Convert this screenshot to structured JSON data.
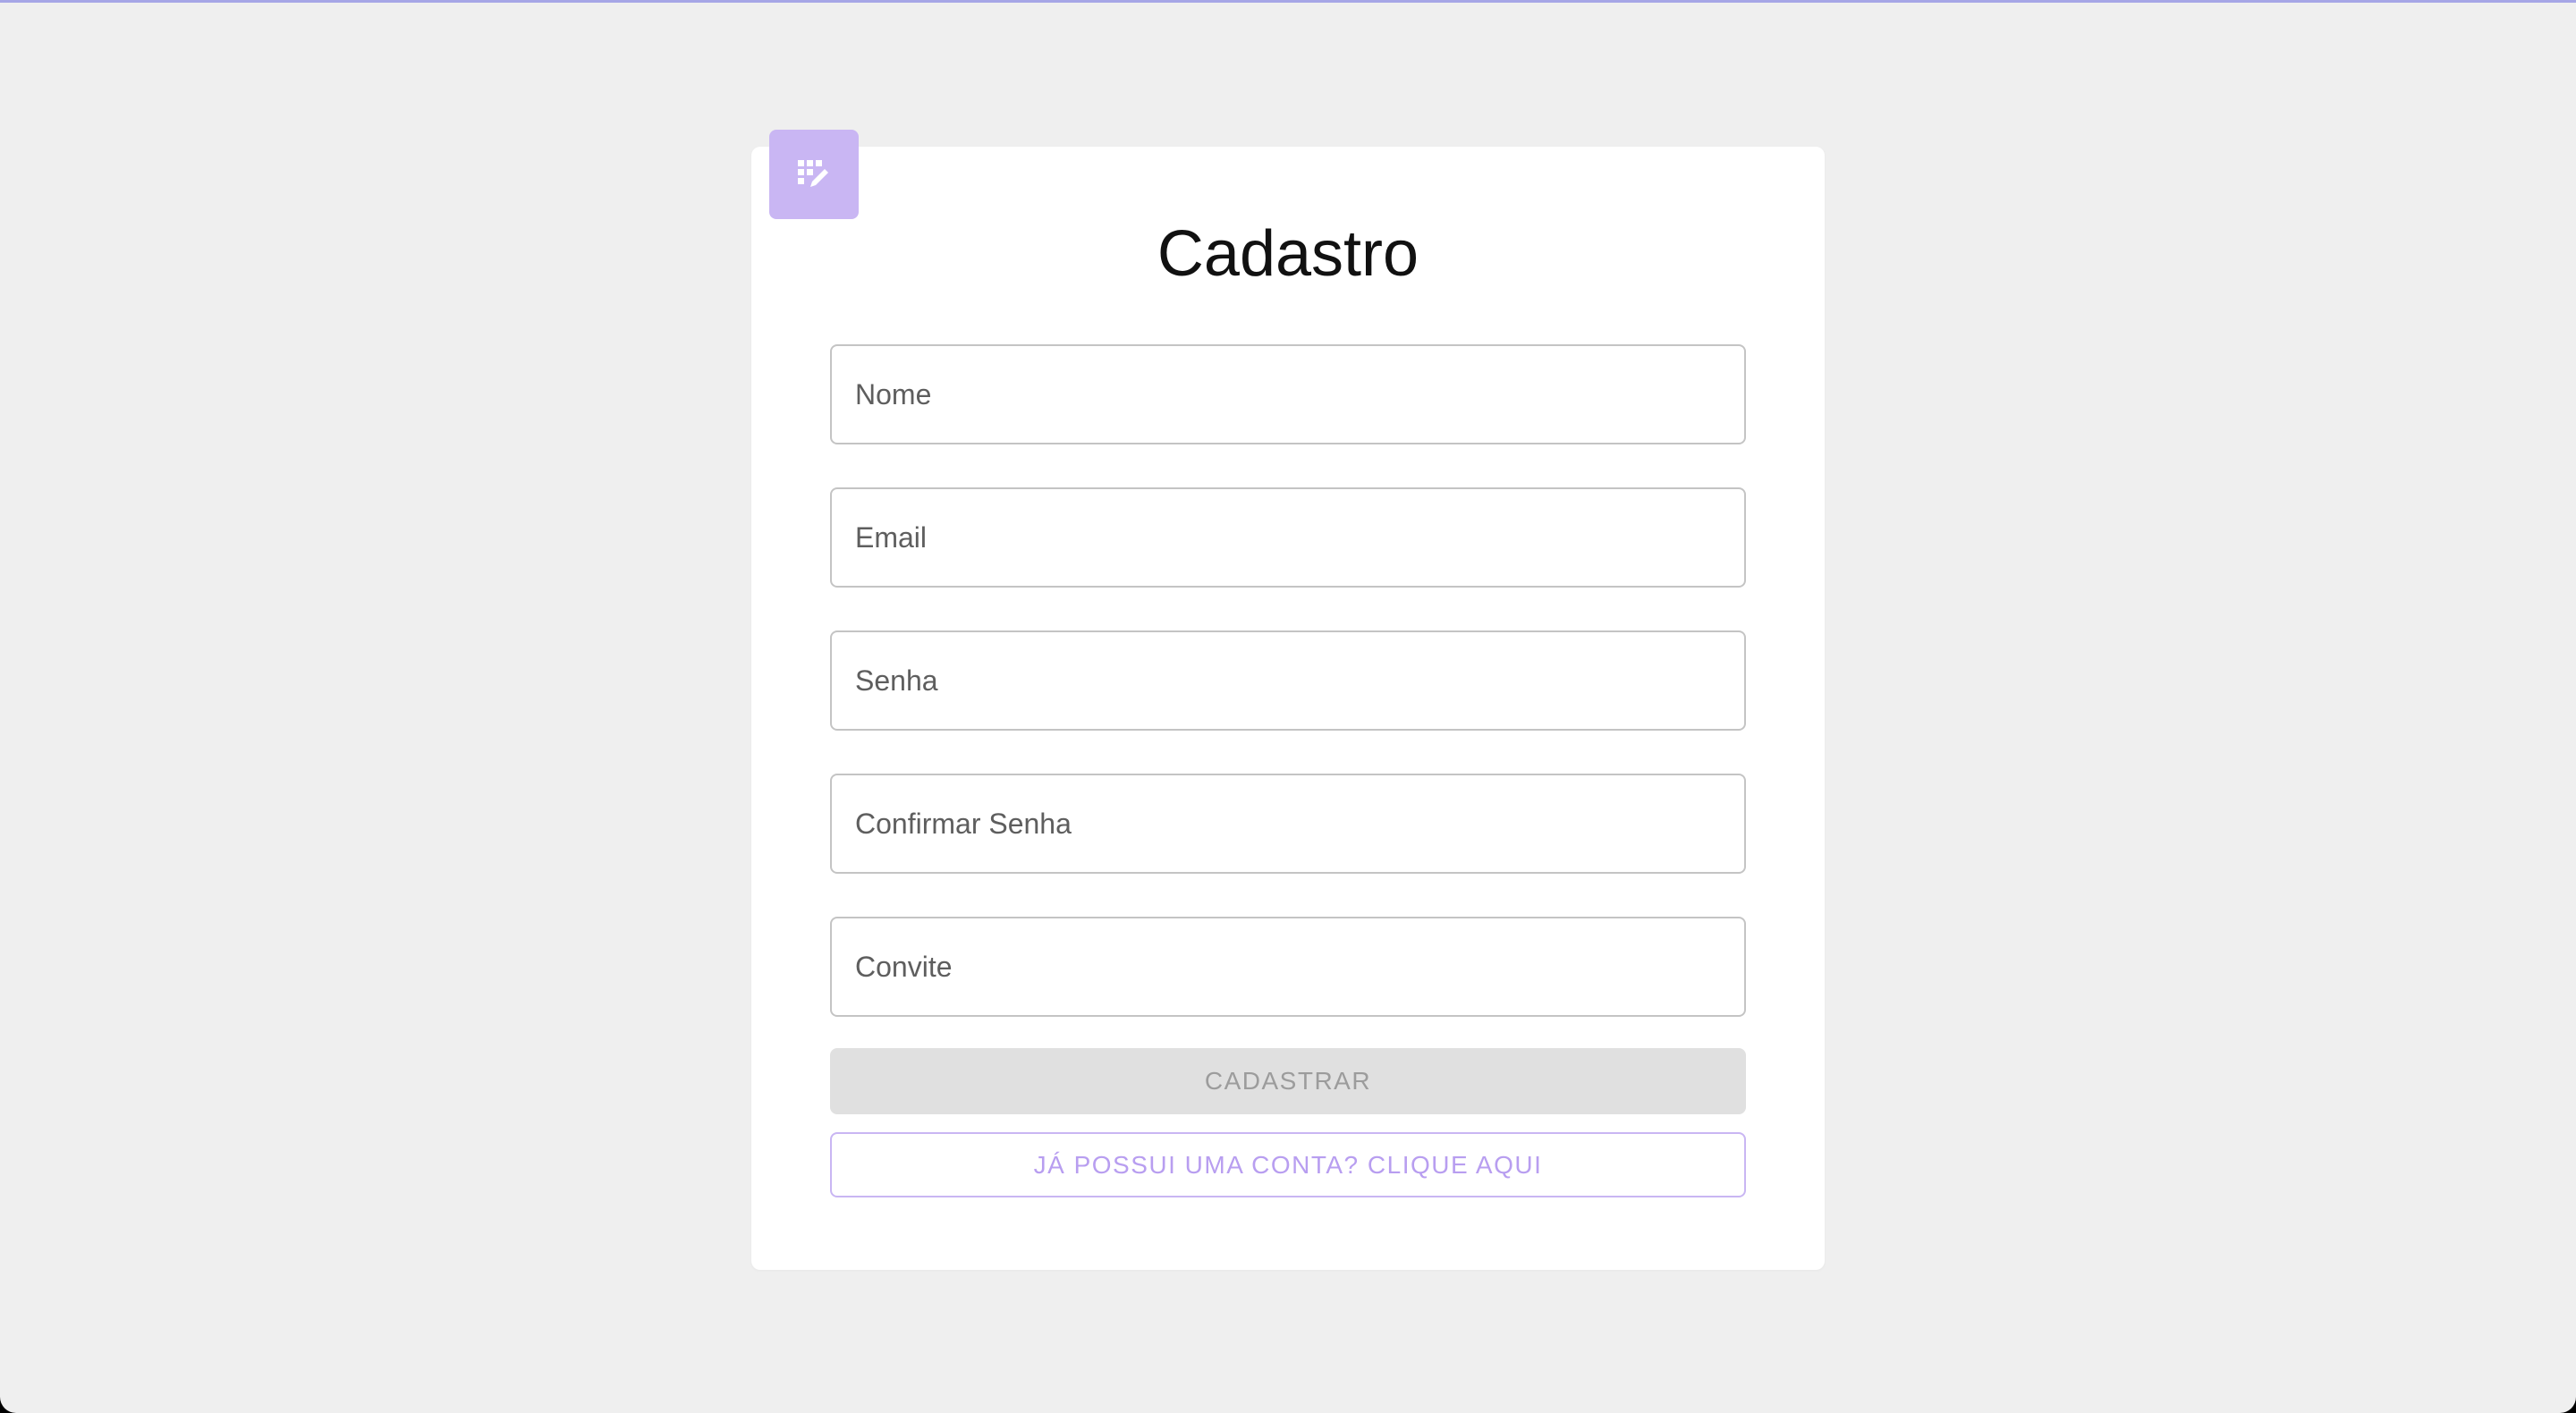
{
  "form": {
    "title": "Cadastro",
    "fields": [
      {
        "placeholder": "Nome",
        "value": ""
      },
      {
        "placeholder": "Email",
        "value": ""
      },
      {
        "placeholder": "Senha",
        "value": ""
      },
      {
        "placeholder": "Confirmar Senha",
        "value": ""
      },
      {
        "placeholder": "Convite",
        "value": ""
      }
    ],
    "submit_label": "CADASTRAR",
    "login_label": "JÁ POSSUI UMA CONTA? CLIQUE AQUI"
  },
  "logo": {
    "icon": "app-register-icon"
  },
  "colors": {
    "background": "#efefef",
    "card": "#ffffff",
    "accent": "#c9b6f3",
    "accent_text": "#b89ef0",
    "disabled_bg": "#e0e0e0",
    "disabled_text": "#9c9c9c",
    "top_line": "#a6a6e6"
  }
}
